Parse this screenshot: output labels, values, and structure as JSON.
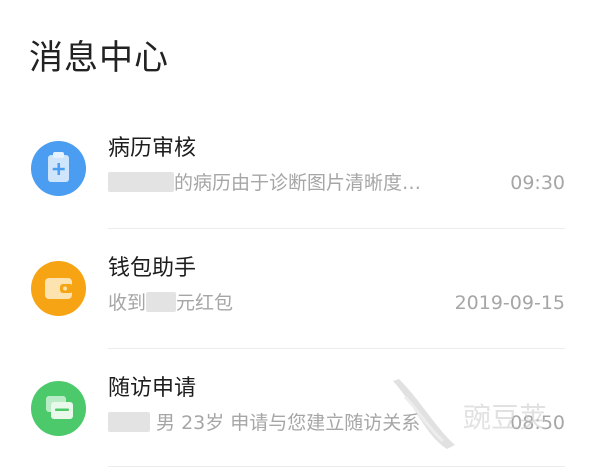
{
  "page": {
    "title": "消息中心"
  },
  "messages": [
    {
      "name": "病历审核",
      "icon": "medical-record-icon",
      "icon_color": "#4a9df0",
      "preview_text": "的病历由于诊断图片清晰度…",
      "time": "09:30"
    },
    {
      "name": "钱包助手",
      "icon": "wallet-icon",
      "icon_color": "#f7a414",
      "preview_prefix": "收到",
      "preview_suffix": "元红包",
      "time": "2019-09-15"
    },
    {
      "name": "随访申请",
      "icon": "chat-bubble-icon",
      "icon_color": "#4cc96a",
      "preview_text": "男 23岁  申请与您建立随访关系",
      "time": "08:50"
    }
  ],
  "colors": {
    "title": "#222222",
    "name": "#1e1e1e",
    "secondary": "#a6a6a6",
    "divider": "#ececec"
  },
  "watermark": {
    "text": "豌豆荚"
  }
}
